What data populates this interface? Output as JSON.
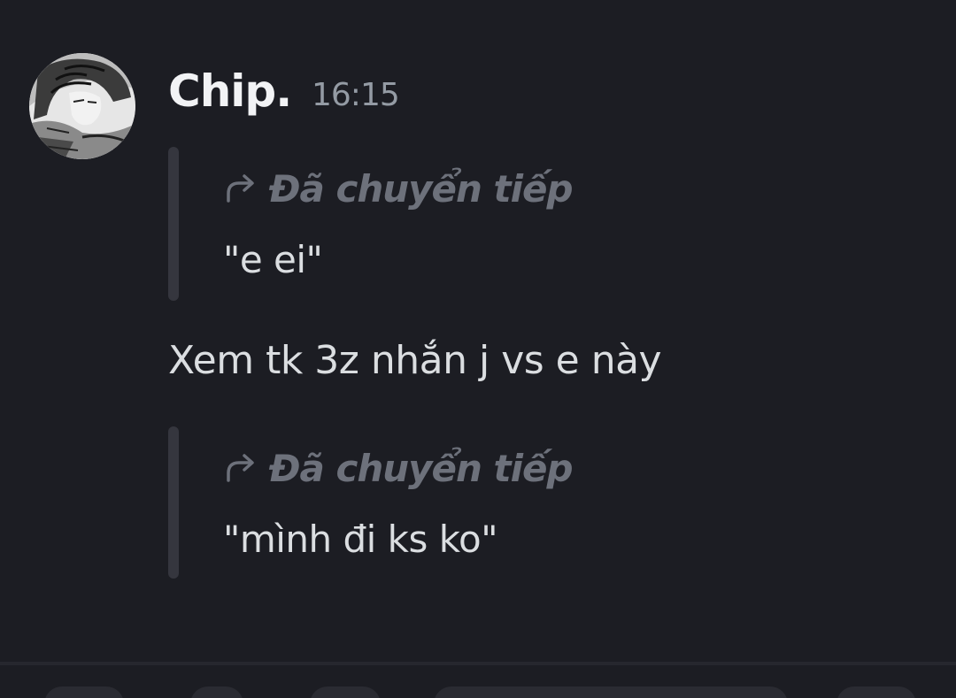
{
  "message": {
    "author": "Chip.",
    "timestamp": "16:15",
    "forwarded": [
      {
        "label": "Đã chuyển tiếp",
        "text": "\"e ei\""
      },
      {
        "label": "Đã chuyển tiếp",
        "text": "\"mình đi ks ko\""
      }
    ],
    "text": "Xem tk 3z nhắn j vs e này"
  },
  "colors": {
    "background": "#1c1d23",
    "author": "#f2f3f5",
    "timestamp": "#949ba4",
    "forward_label": "#6d717b",
    "forward_bar": "#35363e",
    "body_text": "#dbdee1"
  },
  "icons": {
    "forward": "forward-arrow-icon",
    "avatar": "manga-portrait"
  }
}
